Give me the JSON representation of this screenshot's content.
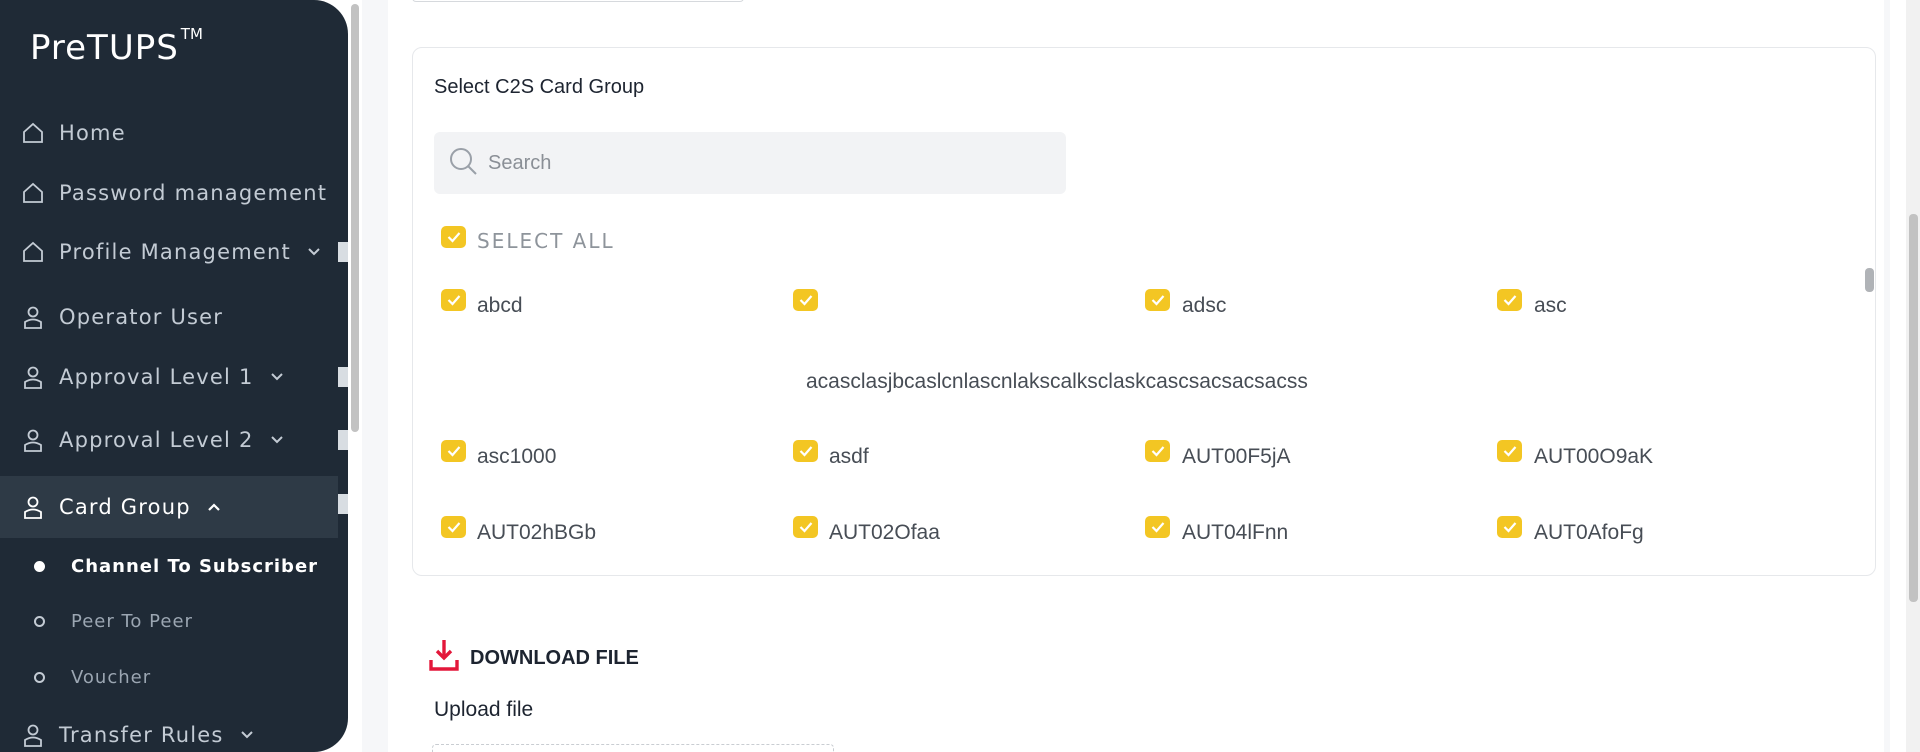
{
  "app": {
    "logo": "PreTUPS",
    "logo_mark": "TM"
  },
  "sidebar": {
    "items": [
      {
        "label": "Home",
        "icon": "home-icon"
      },
      {
        "label": "Password management",
        "icon": "home-icon"
      },
      {
        "label": "Profile Management",
        "icon": "home-icon",
        "expandable": true
      },
      {
        "label": "Operator User",
        "icon": "user-icon"
      },
      {
        "label": "Approval Level 1",
        "icon": "user-icon",
        "expandable": true
      },
      {
        "label": "Approval Level 2",
        "icon": "user-icon",
        "expandable": true
      },
      {
        "label": "Card Group",
        "icon": "user-icon",
        "expandable": true,
        "expanded": true,
        "active": true
      },
      {
        "label": "Transfer Rules",
        "icon": "user-icon",
        "expandable": true
      }
    ],
    "sub_items": [
      {
        "label": "Channel To Subscriber",
        "active": true
      },
      {
        "label": "Peer To Peer",
        "active": false
      },
      {
        "label": "Voucher",
        "active": false
      }
    ]
  },
  "card_group_section": {
    "title": "Select C2S Card Group",
    "search_placeholder": "Search",
    "select_all_label": "SELECT ALL",
    "select_all_checked": true,
    "options": [
      {
        "label": "abcd",
        "checked": true
      },
      {
        "label": "acasclasjbcaslcnlascnlakscalksclaskcascsacsacsacss",
        "checked": true
      },
      {
        "label": "adsc",
        "checked": true
      },
      {
        "label": "asc",
        "checked": true
      },
      {
        "label": "asc1000",
        "checked": true
      },
      {
        "label": "asdf",
        "checked": true
      },
      {
        "label": "AUT00F5jA",
        "checked": true
      },
      {
        "label": "AUT00O9aK",
        "checked": true
      },
      {
        "label": "AUT02hBGb",
        "checked": true
      },
      {
        "label": "AUT02Ofaa",
        "checked": true
      },
      {
        "label": "AUT04lFnn",
        "checked": true
      },
      {
        "label": "AUT0AfoFg",
        "checked": true
      }
    ]
  },
  "download": {
    "label": "DOWNLOAD FILE",
    "icon": "download-icon"
  },
  "upload": {
    "label": "Upload file"
  },
  "colors": {
    "sidebar_bg": "#1f2a36",
    "sidebar_active": "#2e3a46",
    "checkbox": "#f3c623",
    "download_icon": "#e3173a"
  }
}
